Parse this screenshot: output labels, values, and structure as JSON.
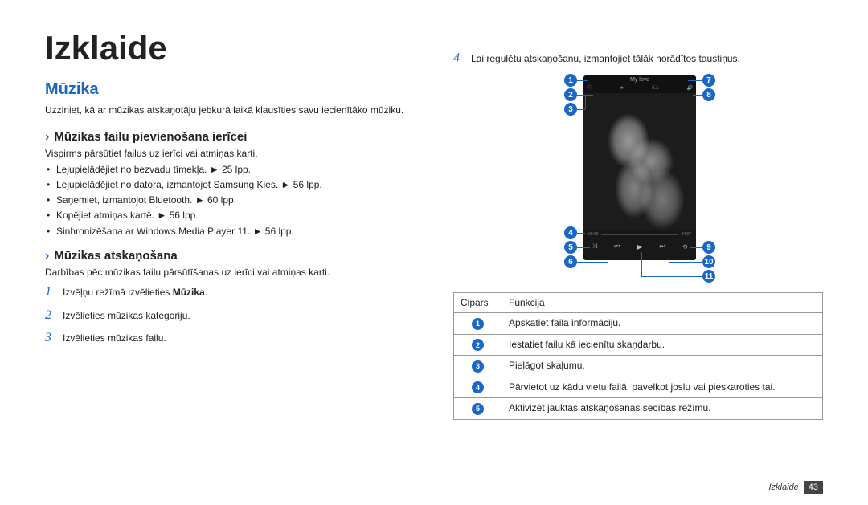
{
  "page": {
    "title": "Izklaide",
    "section": "Mūzika",
    "intro": "Uzziniet, kā ar mūzikas atskaņotāju jebkurā laikā klausīties savu iecienītāko mūziku.",
    "sub1_title": "Mūzikas failu pievienošana ierīcei",
    "sub1_intro": "Vispirms pārsūtiet failus uz ierīci vai atmiņas karti.",
    "bullets": [
      "Lejupielādējiet no bezvadu tīmekļa. ► 25 lpp.",
      "Lejupielādējiet no datora, izmantojot Samsung Kies. ► 56 lpp.",
      "Saņemiet, izmantojot Bluetooth. ► 60 lpp.",
      "Kopējiet atmiņas kartē. ► 56 lpp.",
      "Sinhronizēšana ar Windows Media Player 11. ► 56 lpp."
    ],
    "sub2_title": "Mūzikas atskaņošana",
    "sub2_intro": "Darbības pēc mūzikas failu pārsūtīšanas uz ierīci vai atmiņas karti.",
    "steps": [
      {
        "n": "1",
        "pre": "Izvēļņu režīmā izvēlieties ",
        "bold": "Mūzika",
        "post": "."
      },
      {
        "n": "2",
        "pre": "Izvēlieties mūzikas kategoriju.",
        "bold": "",
        "post": ""
      },
      {
        "n": "3",
        "pre": "Izvēlieties mūzikas failu.",
        "bold": "",
        "post": ""
      }
    ]
  },
  "right": {
    "step4_n": "4",
    "step4_text": "Lai regulētu atskaņošanu, izmantojiet tālāk norādītos taustiņus.",
    "track_title": "My love",
    "table_headers": {
      "cipars": "Cipars",
      "funkcija": "Funkcija"
    },
    "rows": [
      {
        "n": "1",
        "f": "Apskatiet faila informāciju."
      },
      {
        "n": "2",
        "f": "Iestatiet failu kā iecienītu skaņdarbu."
      },
      {
        "n": "3",
        "f": "Pielāgot skaļumu."
      },
      {
        "n": "4",
        "f": "Pārvietot uz kādu vietu failā, pavelkot joslu vai pieskaroties tai."
      },
      {
        "n": "5",
        "f": "Aktivizēt jauktas atskaņošanas secības režīmu."
      }
    ],
    "callouts": [
      "1",
      "2",
      "3",
      "4",
      "5",
      "6",
      "7",
      "8",
      "9",
      "10",
      "11"
    ]
  },
  "footer": {
    "label": "Izklaide",
    "page": "43"
  }
}
